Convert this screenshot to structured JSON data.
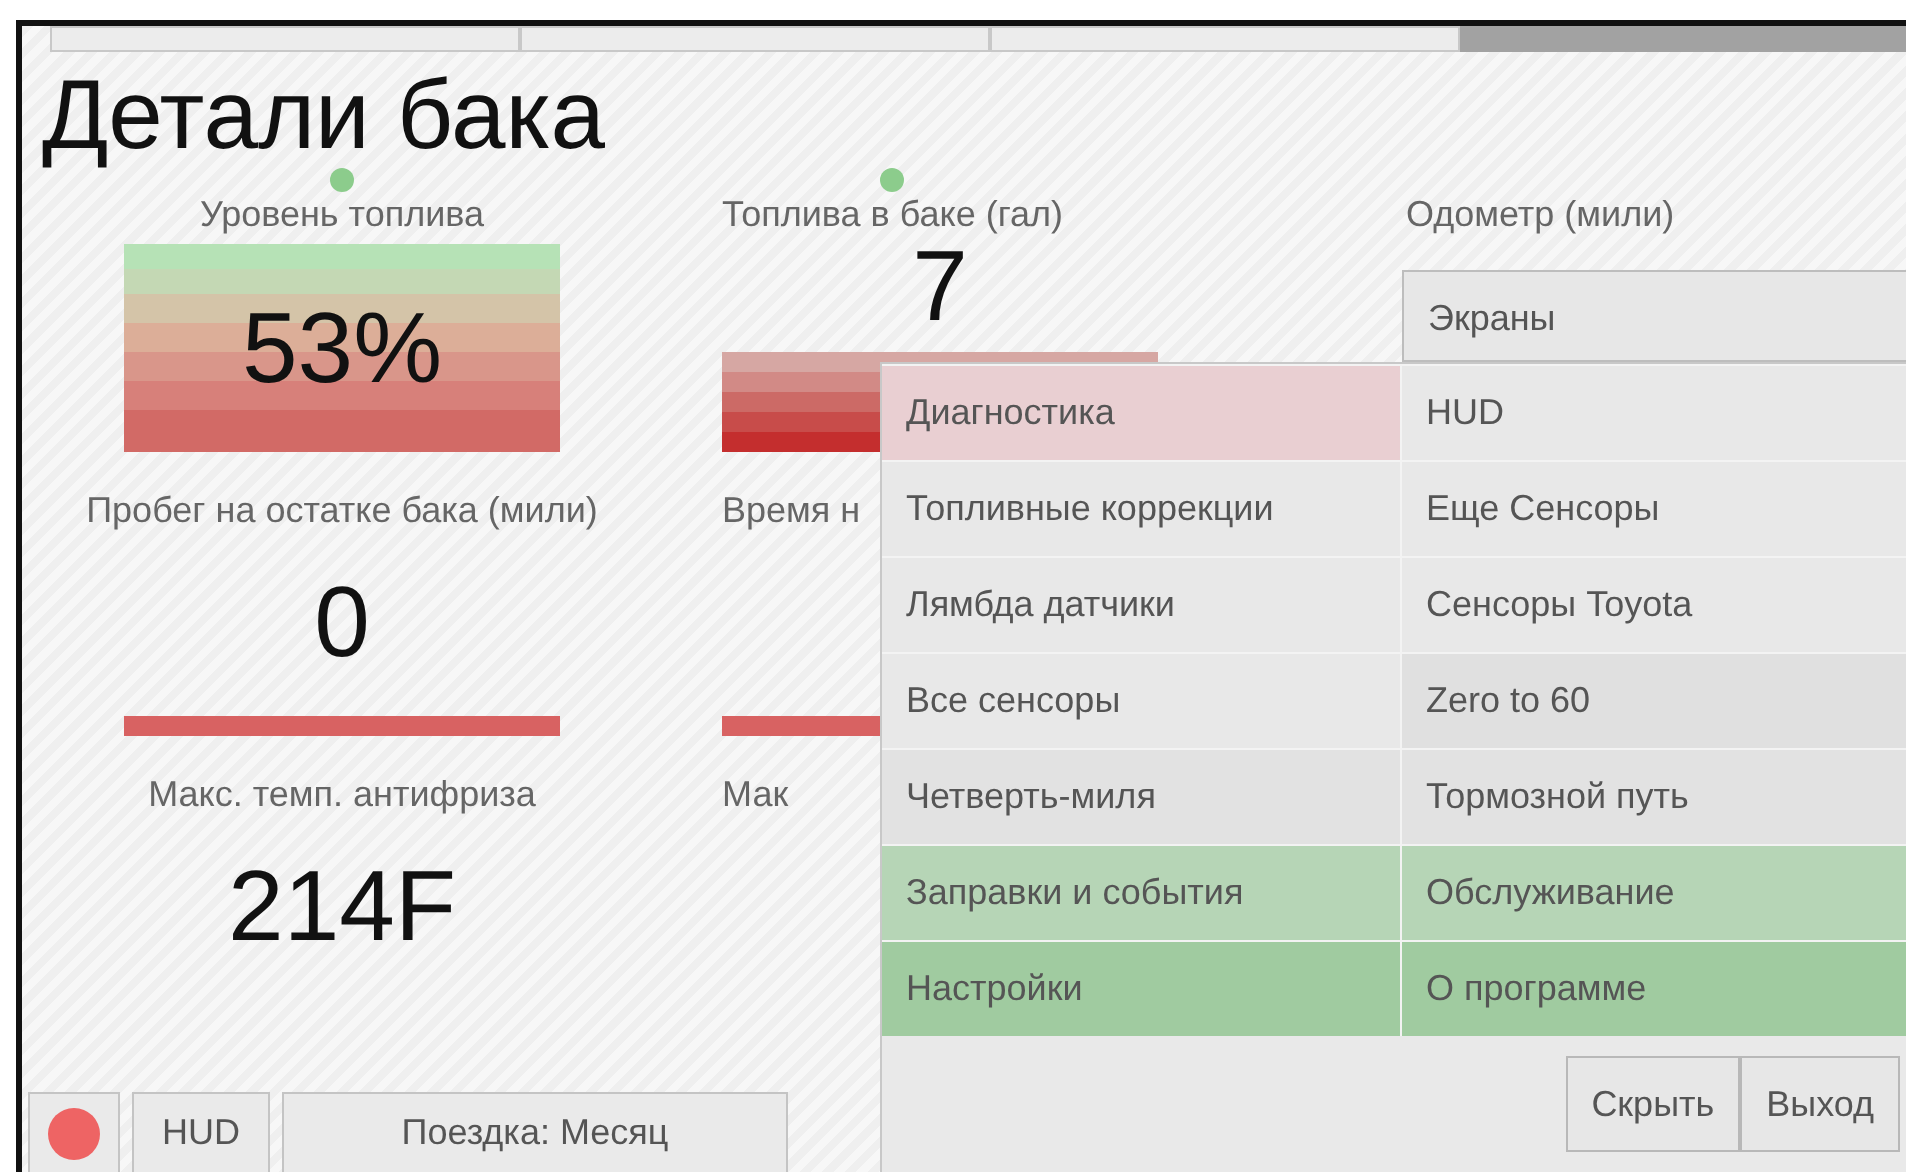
{
  "tabs": [
    {
      "selected": false
    },
    {
      "selected": false
    },
    {
      "selected": false
    },
    {
      "selected": true
    }
  ],
  "title": "Детали бака",
  "gauge_rows": [
    [
      {
        "label": "Уровень топлива",
        "value": "53%",
        "kind": "full-bands",
        "indicator": true
      },
      {
        "label": "Топлива в баке (гал)",
        "value": "7",
        "kind": "low-bands",
        "indicator": true
      },
      {
        "label": "Одометр (мили)",
        "kind": "none",
        "indicator": false
      }
    ],
    [
      {
        "label": "Пробег на остатке бака (мили)",
        "value": "0",
        "kind": "line",
        "indicator": false
      },
      {
        "label": "Время н",
        "kind": "line",
        "indicator": false
      }
    ],
    [
      {
        "label": "Макс. темп. антифриза",
        "value": "214F",
        "kind": "none",
        "indicator": false
      },
      {
        "label": "Мак",
        "kind": "none",
        "indicator": false
      }
    ]
  ],
  "menu": {
    "header": "Экраны",
    "rows": [
      [
        {
          "label": "Диагностика",
          "color": "#e9cfd2"
        },
        {
          "label": "HUD",
          "color": "#e8e8e8"
        }
      ],
      [
        {
          "label": "Топливные коррекции",
          "color": "#e8e8e8"
        },
        {
          "label": "Еще Сенсоры",
          "color": "#e8e8e8"
        }
      ],
      [
        {
          "label": "Лямбда датчики",
          "color": "#e8e8e8"
        },
        {
          "label": "Сенсоры Toyota",
          "color": "#e8e8e8"
        }
      ],
      [
        {
          "label": "Все сенсоры",
          "color": "#e8e8e8"
        },
        {
          "label": "Zero to 60",
          "color": "#e0e0e0"
        }
      ],
      [
        {
          "label": "Четверть-миля",
          "color": "#e2e2e2"
        },
        {
          "label": "Тормозной путь",
          "color": "#e2e2e2"
        }
      ],
      [
        {
          "label": "Заправки и события",
          "color": "#b6d5b6"
        },
        {
          "label": "Обслуживание",
          "color": "#b6d5b6"
        }
      ],
      [
        {
          "label": "Настройки",
          "color": "#a0cba0"
        },
        {
          "label": "О программе",
          "color": "#a0cba0"
        }
      ]
    ],
    "buttons": [
      "Скрыть",
      "Выход"
    ]
  },
  "bottom_bar": {
    "record": true,
    "buttons": [
      "HUD",
      "Поездка: Месяц"
    ]
  }
}
